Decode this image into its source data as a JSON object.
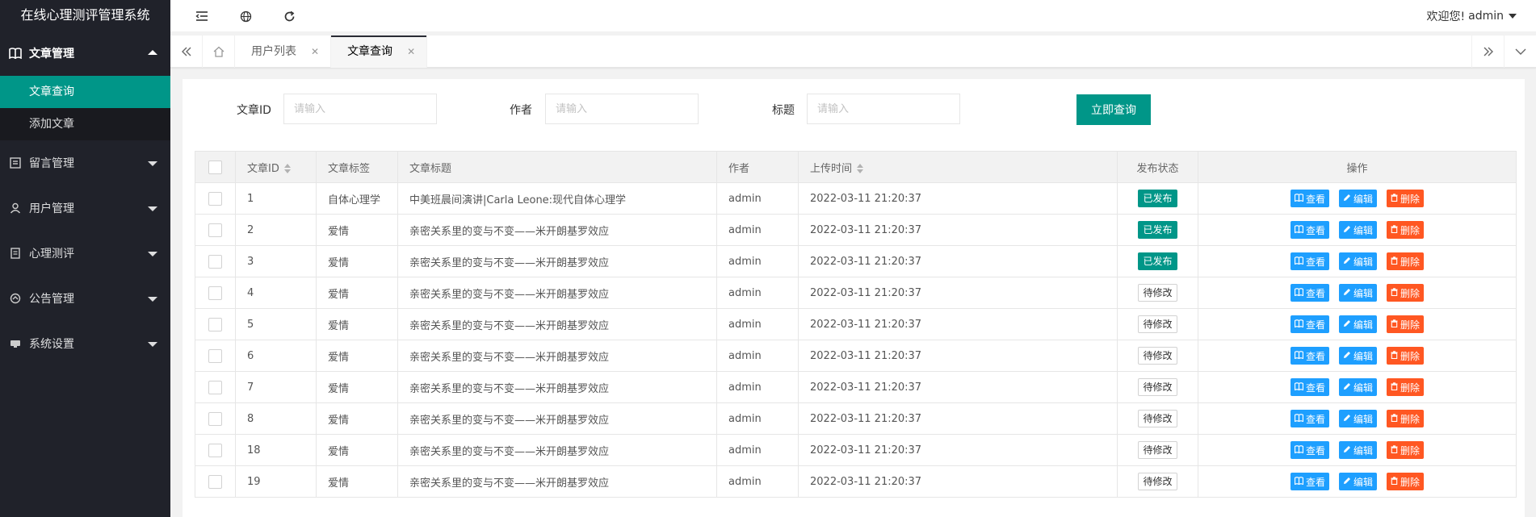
{
  "app": {
    "title": "在线心理测评管理系统"
  },
  "header": {
    "user_greeting": "欢迎您!",
    "username": "admin"
  },
  "sidebar": {
    "groups": [
      {
        "label": "文章管理",
        "icon": "book-icon",
        "open": true,
        "items": [
          {
            "label": "文章查询",
            "active": true
          },
          {
            "label": "添加文章",
            "active": false
          }
        ]
      },
      {
        "label": "留言管理",
        "icon": "message-icon",
        "open": false
      },
      {
        "label": "用户管理",
        "icon": "user-icon",
        "open": false
      },
      {
        "label": "心理测评",
        "icon": "document-icon",
        "open": false
      },
      {
        "label": "公告管理",
        "icon": "announcement-icon",
        "open": false
      },
      {
        "label": "系统设置",
        "icon": "settings-icon",
        "open": false
      }
    ]
  },
  "tabs": [
    {
      "label": "用户列表",
      "active": false
    },
    {
      "label": "文章查询",
      "active": true
    }
  ],
  "search": {
    "fields": [
      {
        "label": "文章ID",
        "placeholder": "请输入",
        "value": ""
      },
      {
        "label": "作者",
        "placeholder": "请输入",
        "value": ""
      },
      {
        "label": "标题",
        "placeholder": "请输入",
        "value": ""
      }
    ],
    "button_label": "立即查询"
  },
  "table": {
    "columns": [
      "文章ID",
      "文章标签",
      "文章标题",
      "作者",
      "上传时间",
      "发布状态",
      "操作"
    ],
    "actions": {
      "view": "查看",
      "edit": "编辑",
      "delete": "删除"
    },
    "rows": [
      {
        "id": "1",
        "tag": "自体心理学",
        "title": "中美班晨间演讲|Carla Leone:现代自体心理学",
        "author": "admin",
        "time": "2022-03-11 21:20:37",
        "status": "已发布",
        "published": true
      },
      {
        "id": "2",
        "tag": "爱情",
        "title": "亲密关系里的变与不变——米开朗基罗效应",
        "author": "admin",
        "time": "2022-03-11 21:20:37",
        "status": "已发布",
        "published": true
      },
      {
        "id": "3",
        "tag": "爱情",
        "title": "亲密关系里的变与不变——米开朗基罗效应",
        "author": "admin",
        "time": "2022-03-11 21:20:37",
        "status": "已发布",
        "published": true
      },
      {
        "id": "4",
        "tag": "爱情",
        "title": "亲密关系里的变与不变——米开朗基罗效应",
        "author": "admin",
        "time": "2022-03-11 21:20:37",
        "status": "待修改",
        "published": false
      },
      {
        "id": "5",
        "tag": "爱情",
        "title": "亲密关系里的变与不变——米开朗基罗效应",
        "author": "admin",
        "time": "2022-03-11 21:20:37",
        "status": "待修改",
        "published": false
      },
      {
        "id": "6",
        "tag": "爱情",
        "title": "亲密关系里的变与不变——米开朗基罗效应",
        "author": "admin",
        "time": "2022-03-11 21:20:37",
        "status": "待修改",
        "published": false
      },
      {
        "id": "7",
        "tag": "爱情",
        "title": "亲密关系里的变与不变——米开朗基罗效应",
        "author": "admin",
        "time": "2022-03-11 21:20:37",
        "status": "待修改",
        "published": false
      },
      {
        "id": "8",
        "tag": "爱情",
        "title": "亲密关系里的变与不变——米开朗基罗效应",
        "author": "admin",
        "time": "2022-03-11 21:20:37",
        "status": "待修改",
        "published": false
      },
      {
        "id": "18",
        "tag": "爱情",
        "title": "亲密关系里的变与不变——米开朗基罗效应",
        "author": "admin",
        "time": "2022-03-11 21:20:37",
        "status": "待修改",
        "published": false
      },
      {
        "id": "19",
        "tag": "爱情",
        "title": "亲密关系里的变与不变——米开朗基罗效应",
        "author": "admin",
        "time": "2022-03-11 21:20:37",
        "status": "待修改",
        "published": false
      }
    ]
  },
  "colors": {
    "accent": "#009688",
    "sidebar": "#20222a",
    "view": "#1e9fff",
    "delete": "#ff5722"
  }
}
